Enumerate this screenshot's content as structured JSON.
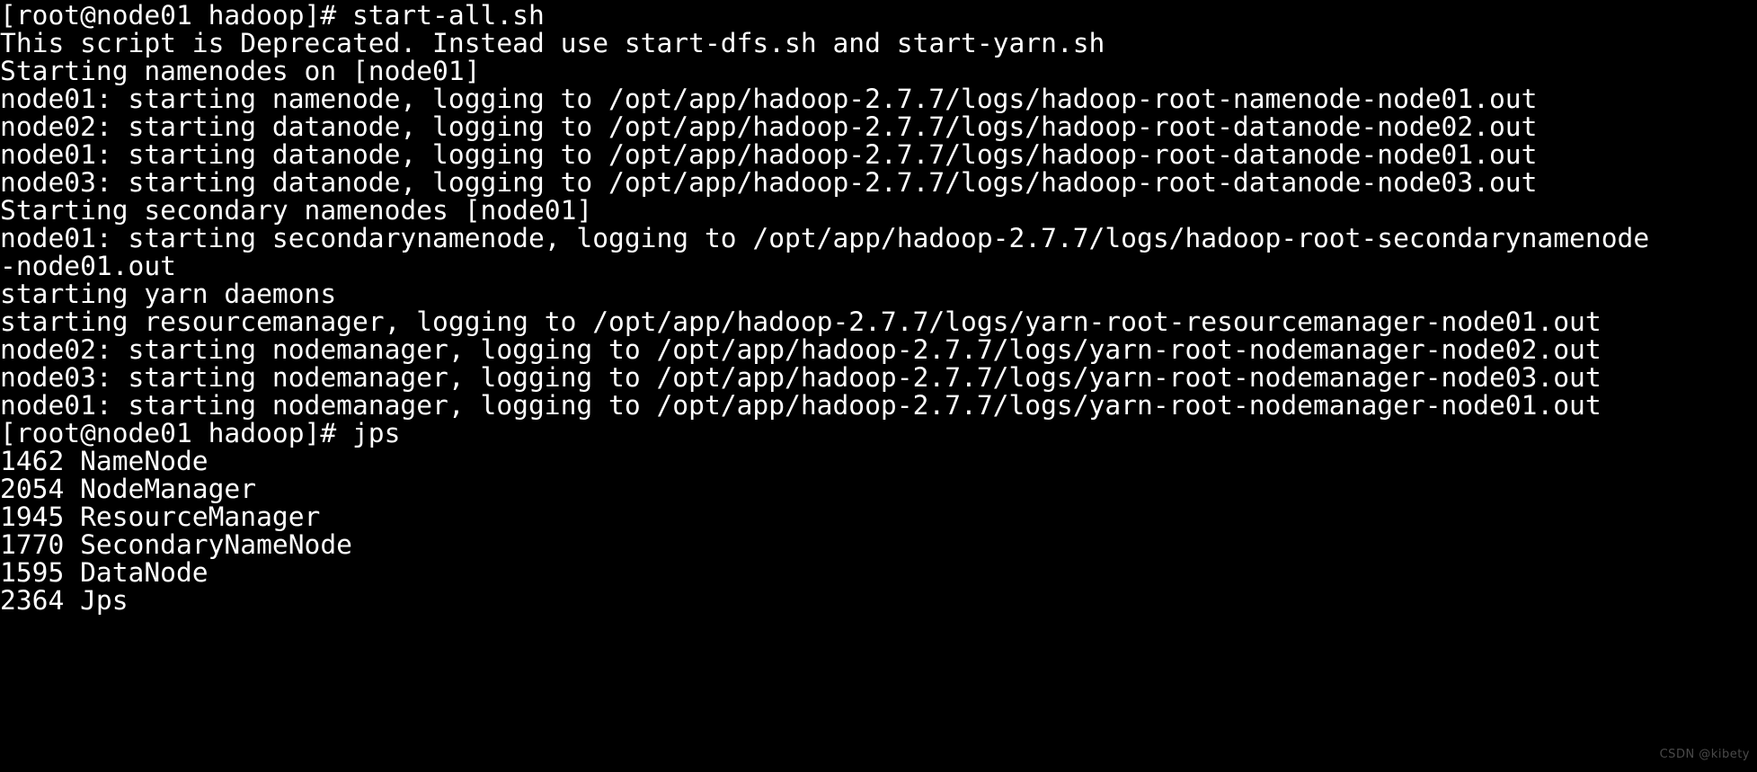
{
  "terminal": {
    "background_color": "#000000",
    "foreground_color": "#ffffff",
    "prompt": "[root@node01 hadoop]#",
    "lines": [
      "[root@node01 hadoop]# start-all.sh",
      "This script is Deprecated. Instead use start-dfs.sh and start-yarn.sh",
      "Starting namenodes on [node01]",
      "node01: starting namenode, logging to /opt/app/hadoop-2.7.7/logs/hadoop-root-namenode-node01.out",
      "node02: starting datanode, logging to /opt/app/hadoop-2.7.7/logs/hadoop-root-datanode-node02.out",
      "node01: starting datanode, logging to /opt/app/hadoop-2.7.7/logs/hadoop-root-datanode-node01.out",
      "node03: starting datanode, logging to /opt/app/hadoop-2.7.7/logs/hadoop-root-datanode-node03.out",
      "Starting secondary namenodes [node01]",
      "node01: starting secondarynamenode, logging to /opt/app/hadoop-2.7.7/logs/hadoop-root-secondarynamenode",
      "-node01.out",
      "starting yarn daemons",
      "starting resourcemanager, logging to /opt/app/hadoop-2.7.7/logs/yarn-root-resourcemanager-node01.out",
      "node02: starting nodemanager, logging to /opt/app/hadoop-2.7.7/logs/yarn-root-nodemanager-node02.out",
      "node03: starting nodemanager, logging to /opt/app/hadoop-2.7.7/logs/yarn-root-nodemanager-node03.out",
      "node01: starting nodemanager, logging to /opt/app/hadoop-2.7.7/logs/yarn-root-nodemanager-node01.out",
      "[root@node01 hadoop]# jps",
      "1462 NameNode",
      "2054 NodeManager",
      "1945 ResourceManager",
      "1770 SecondaryNameNode",
      "1595 DataNode",
      "2364 Jps"
    ],
    "commands": [
      "start-all.sh",
      "jps"
    ],
    "jps_processes": [
      {
        "pid": "1462",
        "name": "NameNode"
      },
      {
        "pid": "2054",
        "name": "NodeManager"
      },
      {
        "pid": "1945",
        "name": "ResourceManager"
      },
      {
        "pid": "1770",
        "name": "SecondaryNameNode"
      },
      {
        "pid": "1595",
        "name": "DataNode"
      },
      {
        "pid": "2364",
        "name": "Jps"
      }
    ]
  },
  "watermark": {
    "text": "CSDN @kibety",
    "color": "#4a4a4a"
  }
}
